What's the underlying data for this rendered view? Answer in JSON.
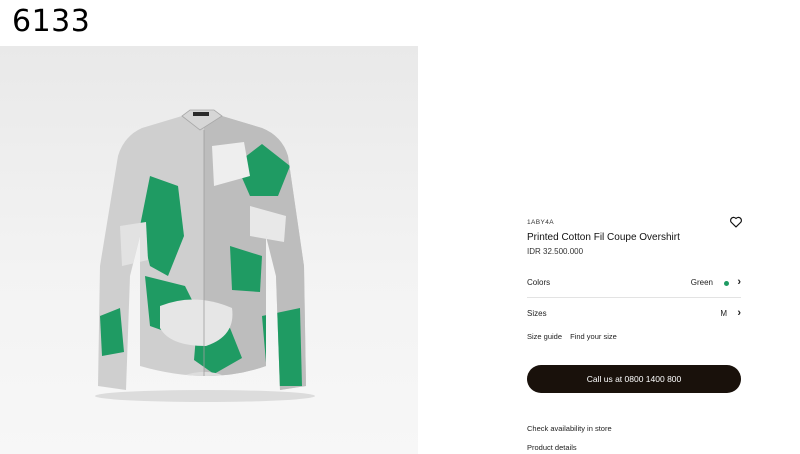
{
  "page_number": "6133",
  "product": {
    "sku": "1ABY4A",
    "title": "Printed Cotton Fil Coupe Overshirt",
    "price": "IDR 32.500.000",
    "colors": {
      "label": "Colors",
      "value": "Green",
      "swatch": "#1f9b63"
    },
    "sizes": {
      "label": "Sizes",
      "value": "M"
    },
    "links": {
      "size_guide": "Size guide",
      "find_size": "Find your size"
    },
    "call_button": "Call us at 0800 1400 800",
    "check_store": "Check availability in store",
    "product_details": "Product details"
  },
  "icons": {
    "wishlist": "heart-outline-icon",
    "colors_chevron": "chevron-right-icon",
    "sizes_chevron": "chevron-right-icon",
    "color_swatch": "green-dot-icon"
  },
  "colors": {
    "button_bg": "#19110b",
    "accent_green": "#1f9b63",
    "shirt_grey": "#c9c9c9"
  }
}
